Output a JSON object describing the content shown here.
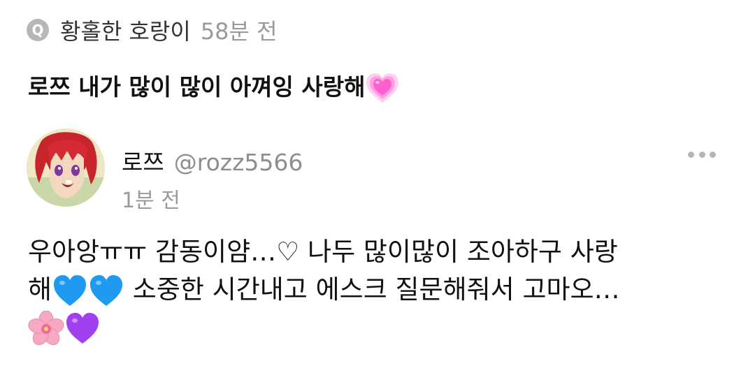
{
  "question": {
    "badge_letter": "Q",
    "asker_name": "황홀한 호랑이",
    "time": "58분 전",
    "text": "로쯔 내가 많이 많이 아껴잉 사랑해",
    "trailing_emoji": "growing-heart-pink"
  },
  "answer": {
    "avatar": "avatar-red-haired-anime-character",
    "name": "로쯔",
    "handle": "@rozz5566",
    "time": "1분 전",
    "more_icon": "more-horizontal-icon",
    "lines": [
      {
        "text": "우아앙ㅠㅠ 감동이얌…♡ 나두 많이많이 조아하구 사랑"
      },
      {
        "text": "해",
        "emoji_after": [
          "blue-heart",
          "blue-heart"
        ],
        "text2": " 소중한 시간내고 에스크 질문해줘서 고마오…"
      },
      {
        "emoji": [
          "cherry-blossom",
          "purple-heart"
        ]
      }
    ]
  },
  "colors": {
    "question_time": "#9a9a9a",
    "handle": "#8e8e8e",
    "badge_bg": "#b7b7b7",
    "pink_heart": "#ff5fcf",
    "blue_heart": "#1e9bf0",
    "purple_heart": "#a040f0",
    "blossom": "#f7a8c4"
  }
}
